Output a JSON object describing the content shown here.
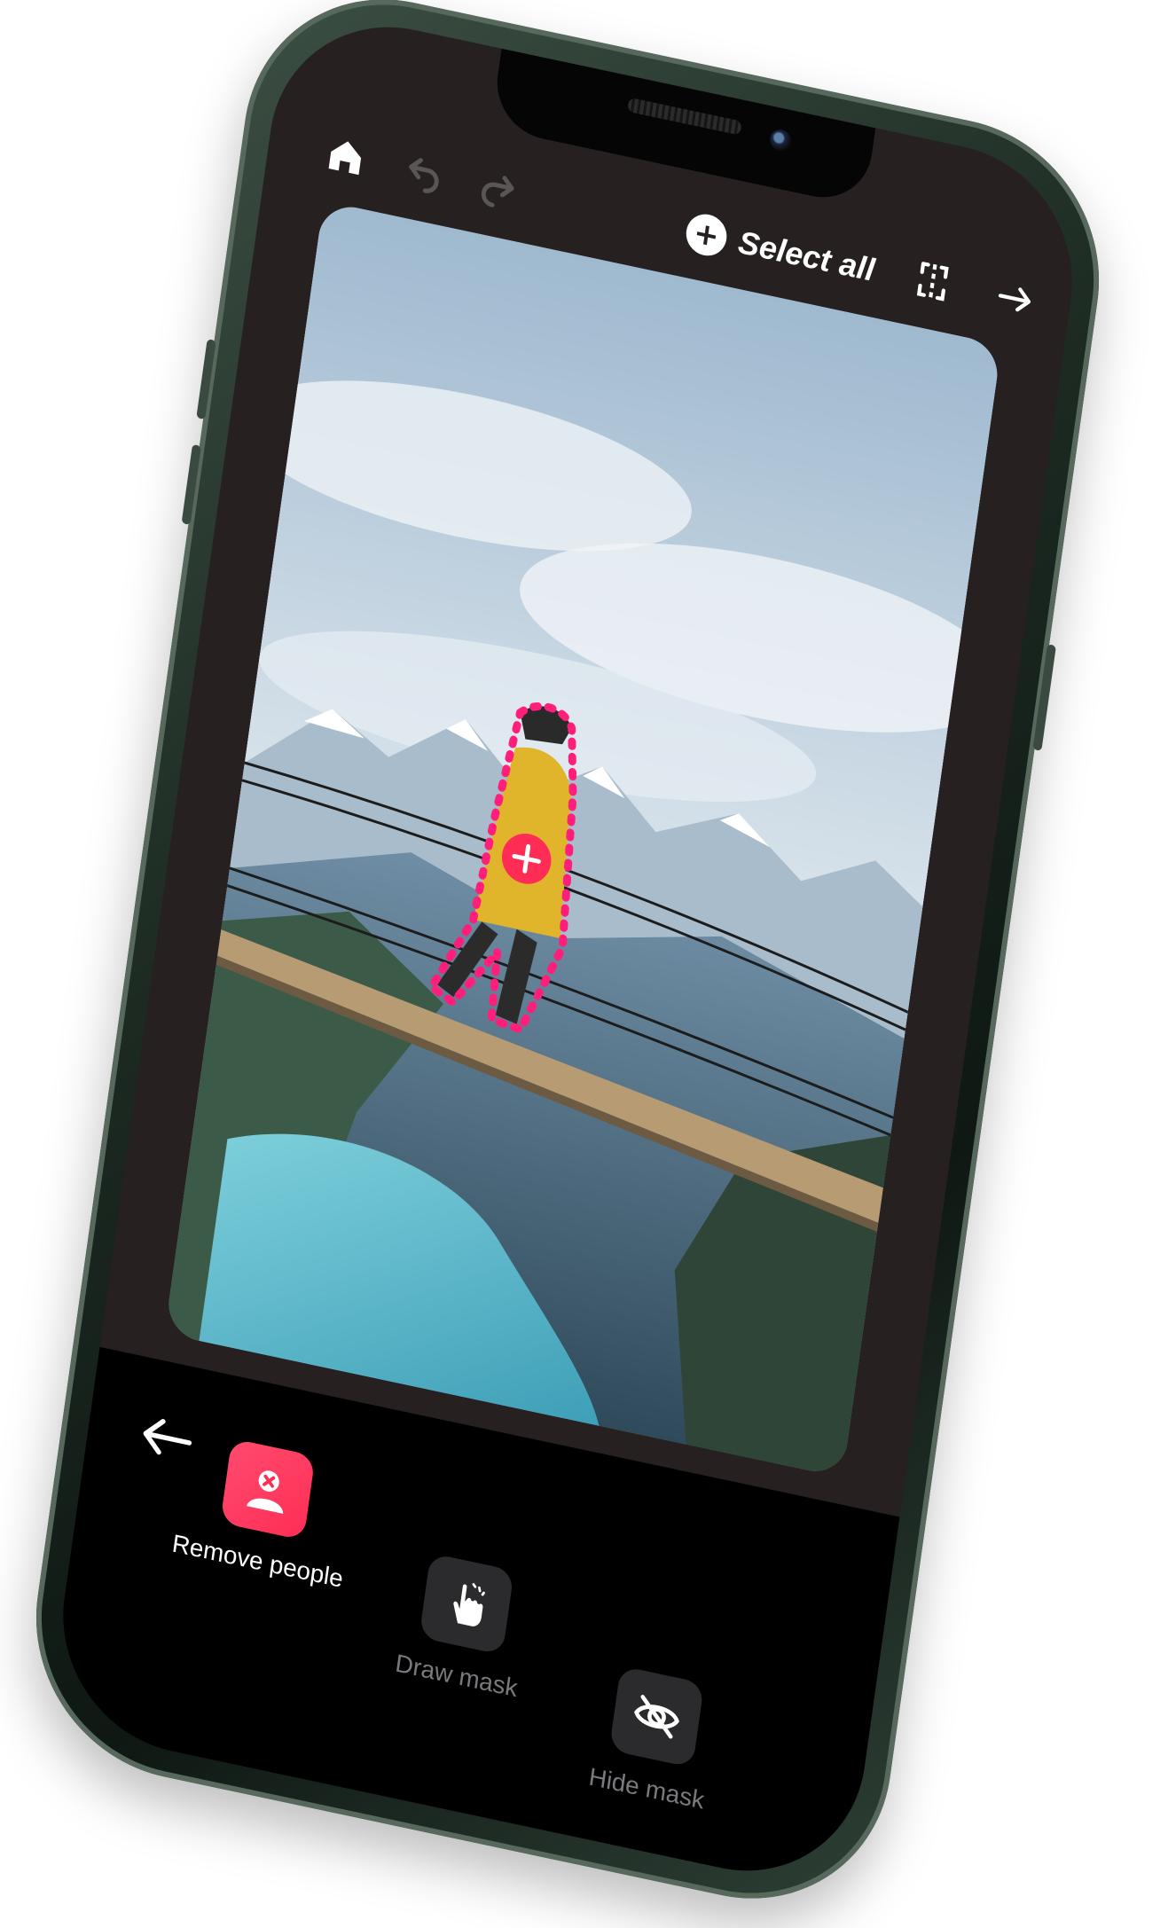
{
  "toolbar": {
    "home_icon": "home-icon",
    "undo_icon": "undo-icon",
    "redo_icon": "redo-icon",
    "select_all_label": "Select all",
    "compare_icon": "compare-icon",
    "next_icon": "arrow-right-icon"
  },
  "canvas": {
    "image_subject": "person on suspension bridge",
    "mask_color": "#ff1f7a",
    "add_icon": "+"
  },
  "tools": {
    "back_icon": "arrow-left-icon",
    "items": [
      {
        "label": "Remove people",
        "icon": "remove-person-icon",
        "active": true
      },
      {
        "label": "Draw mask",
        "icon": "hand-pointer-icon",
        "active": false
      },
      {
        "label": "Hide mask",
        "icon": "eye-off-icon",
        "active": false
      }
    ]
  },
  "colors": {
    "accent": "#ff2d55",
    "screen_bg": "#262020",
    "panel_bg": "#000000",
    "frame": "#1c2a22"
  }
}
